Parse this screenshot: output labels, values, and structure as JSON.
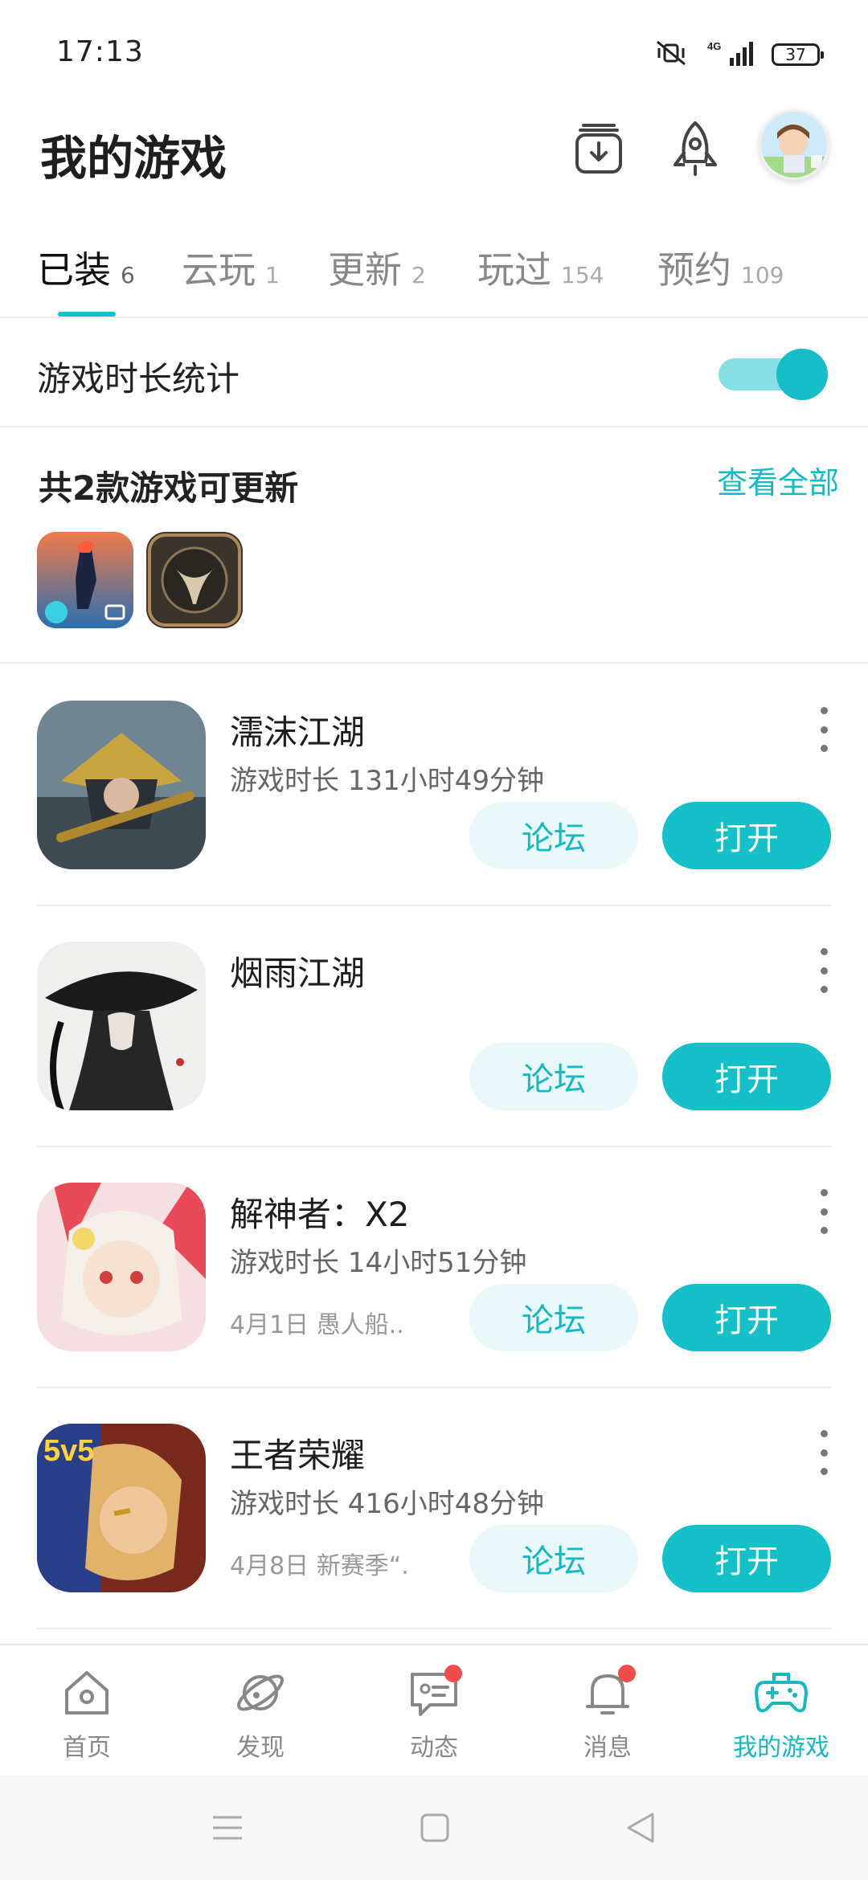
{
  "status_bar": {
    "time": "17:13",
    "battery": "37",
    "network": "4G"
  },
  "header": {
    "title": "我的游戏"
  },
  "tabs": [
    {
      "label": "已装",
      "count": "6",
      "active": true
    },
    {
      "label": "云玩",
      "count": "1",
      "active": false
    },
    {
      "label": "更新",
      "count": "2",
      "active": false
    },
    {
      "label": "玩过",
      "count": "154",
      "active": false
    },
    {
      "label": "预约",
      "count": "109",
      "active": false
    }
  ],
  "stats": {
    "label": "游戏时长统计",
    "enabled": true
  },
  "updates": {
    "title": "共2款游戏可更新",
    "view_all": "查看全部"
  },
  "games": [
    {
      "name": "濡沫江湖",
      "playtime": "游戏时长 131小时49分钟",
      "news": "",
      "forum": "论坛",
      "open": "打开"
    },
    {
      "name": "烟雨江湖",
      "playtime": "",
      "news": "",
      "forum": "论坛",
      "open": "打开"
    },
    {
      "name": "解神者：X2",
      "playtime": "游戏时长 14小时51分钟",
      "news": "4月1日 愚人船...",
      "forum": "论坛",
      "open": "打开"
    },
    {
      "name": "王者荣耀",
      "playtime": "游戏时长 416小时48分钟",
      "news": "4月8日 新赛季“...",
      "forum": "论坛",
      "open": "打开"
    }
  ],
  "bottom_nav": [
    {
      "label": "首页",
      "icon": "home-icon",
      "active": false,
      "badge": false
    },
    {
      "label": "发现",
      "icon": "planet-icon",
      "active": false,
      "badge": false
    },
    {
      "label": "动态",
      "icon": "chat-icon",
      "active": false,
      "badge": true
    },
    {
      "label": "消息",
      "icon": "bell-icon",
      "active": false,
      "badge": true
    },
    {
      "label": "我的游戏",
      "icon": "gamepad-icon",
      "active": true,
      "badge": false
    }
  ],
  "colors": {
    "accent": "#16c0c9",
    "forum_bg": "#e9f8f9",
    "badge": "#f24b4b"
  }
}
